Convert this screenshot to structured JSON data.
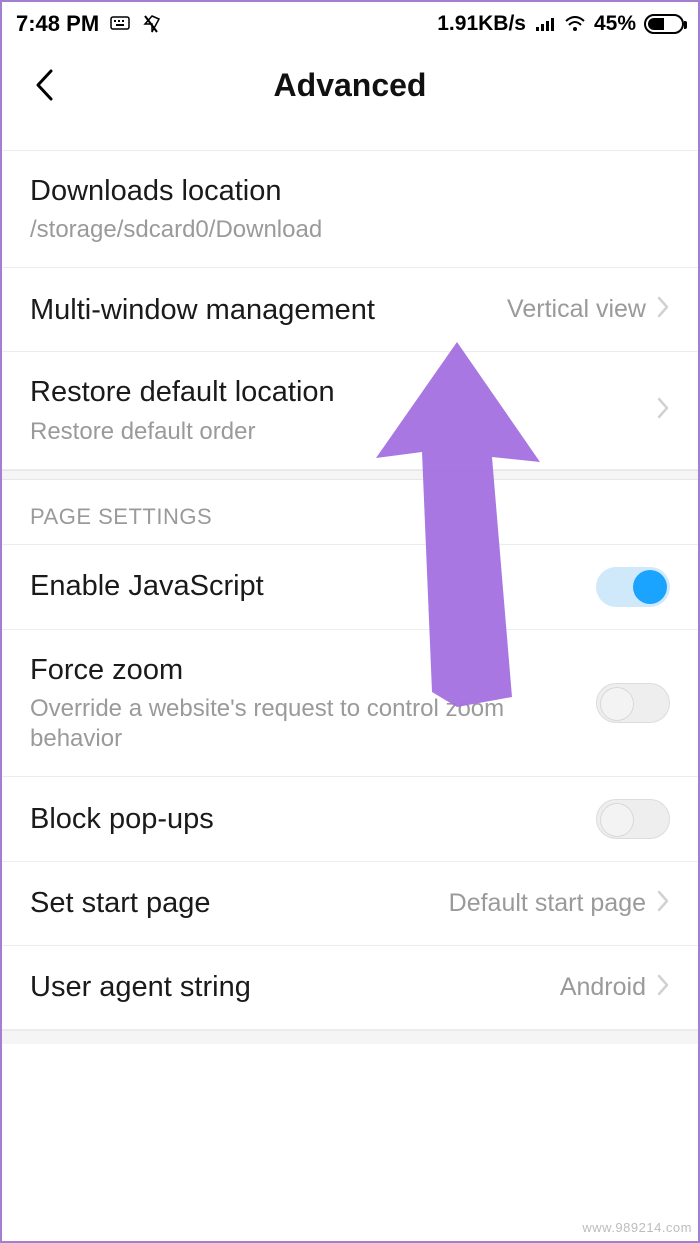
{
  "status": {
    "time": "7:48 PM",
    "net_speed": "1.91KB/s",
    "battery_pct": "45%"
  },
  "header": {
    "title": "Advanced"
  },
  "group1": {
    "downloads": {
      "title": "Downloads location",
      "sub": "/storage/sdcard0/Download"
    },
    "multi_window": {
      "title": "Multi-window management",
      "value": "Vertical view"
    },
    "restore": {
      "title": "Restore default location",
      "sub": "Restore default order"
    }
  },
  "section_page": "PAGE SETTINGS",
  "page_settings": {
    "js": {
      "title": "Enable JavaScript",
      "on": true
    },
    "force_zoom": {
      "title": "Force zoom",
      "sub": "Override a website's request to control zoom behavior",
      "on": false
    },
    "block_popups": {
      "title": "Block pop-ups",
      "on": false
    },
    "start_page": {
      "title": "Set start page",
      "value": "Default start page"
    },
    "ua": {
      "title": "User agent string",
      "value": "Android"
    }
  },
  "watermark": "www.989214.com"
}
